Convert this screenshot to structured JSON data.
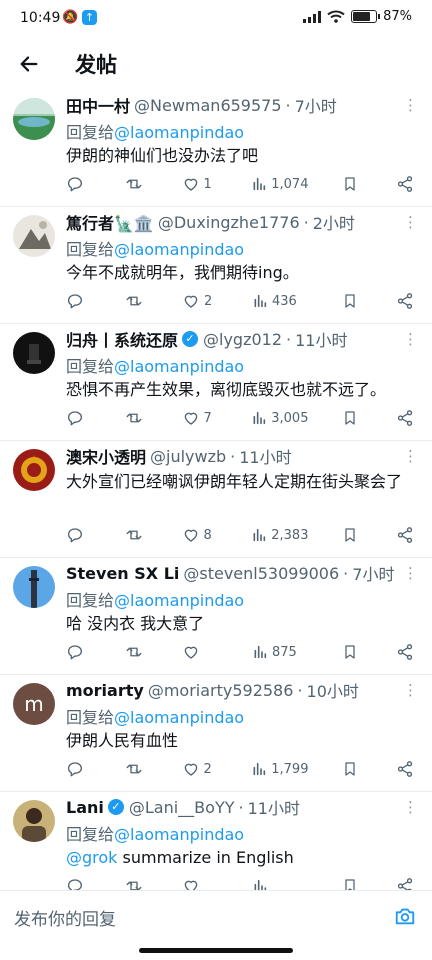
{
  "status_bar": {
    "time": "10:49",
    "battery": "87%"
  },
  "header": {
    "title": "发帖"
  },
  "tweets": [
    {
      "name": "田中一村",
      "handle": "@Newman659575",
      "time": "7小时",
      "reply_prefix": "回复给",
      "reply_to": "@laomanpindao",
      "text": "伊朗的神仙们也没办法了吧",
      "likes": "1",
      "views": "1,074",
      "verified": false,
      "avatar": "landscape-avatar"
    },
    {
      "name": "篤行者🗽🏛️",
      "handle": "@Duxingzhe1776",
      "time": "2小时",
      "reply_prefix": "回复给",
      "reply_to": "@laomanpindao",
      "text": "今年不成就明年，我們期待ing。",
      "likes": "2",
      "views": "436",
      "verified": false,
      "avatar": "sketch-avatar"
    },
    {
      "name": "归舟丨系统还原",
      "handle": "@lygz012",
      "time": "11小时",
      "reply_prefix": "回复给",
      "reply_to": "@laomanpindao",
      "text": "恐惧不再产生效果，离彻底毁灭也就不远了。",
      "likes": "7",
      "views": "3,005",
      "verified": true,
      "avatar": "dark-avatar"
    },
    {
      "name": "澳宋小透明",
      "handle": "@julywzb",
      "time": "11小时",
      "reply_prefix": "",
      "reply_to": "",
      "text": "大外宣们已经嘲讽伊朗年轻人定期在街头聚会了",
      "likes": "8",
      "views": "2,383",
      "verified": false,
      "avatar": "emblem-avatar"
    },
    {
      "name": "Steven SX Li",
      "handle": "@stevenl53099006",
      "time": "7小时",
      "reply_prefix": "回复给",
      "reply_to": "@laomanpindao",
      "text": "哈 没内衣 我大意了",
      "likes": "",
      "views": "875",
      "verified": false,
      "avatar": "tower-avatar"
    },
    {
      "name": "moriarty",
      "handle": "@moriarty592586",
      "time": "10小时",
      "reply_prefix": "回复给",
      "reply_to": "@laomanpindao",
      "text": "伊朗人民有血性",
      "likes": "2",
      "views": "1,799",
      "verified": false,
      "avatar": "letter-m-avatar"
    },
    {
      "name": "Lani",
      "handle": "@Lani__BoYY",
      "time": "11小时",
      "reply_prefix": "回复给",
      "reply_to": "@laomanpindao",
      "text_mention": "@grok",
      "text": " summarize in English",
      "likes": "",
      "views": "",
      "verified": true,
      "avatar": "photo-avatar"
    }
  ],
  "composer": {
    "placeholder": "发布你的回复"
  },
  "icons": {
    "back": "arrow-left-icon",
    "reply": "reply-icon",
    "retweet": "retweet-icon",
    "like": "heart-icon",
    "views": "views-icon",
    "bookmark": "bookmark-icon",
    "share": "share-icon",
    "camera": "camera-icon",
    "more": "more-icon"
  },
  "colors": {
    "accent": "#1d9bf0",
    "secondary_text": "#536471",
    "text": "#0f1419"
  }
}
